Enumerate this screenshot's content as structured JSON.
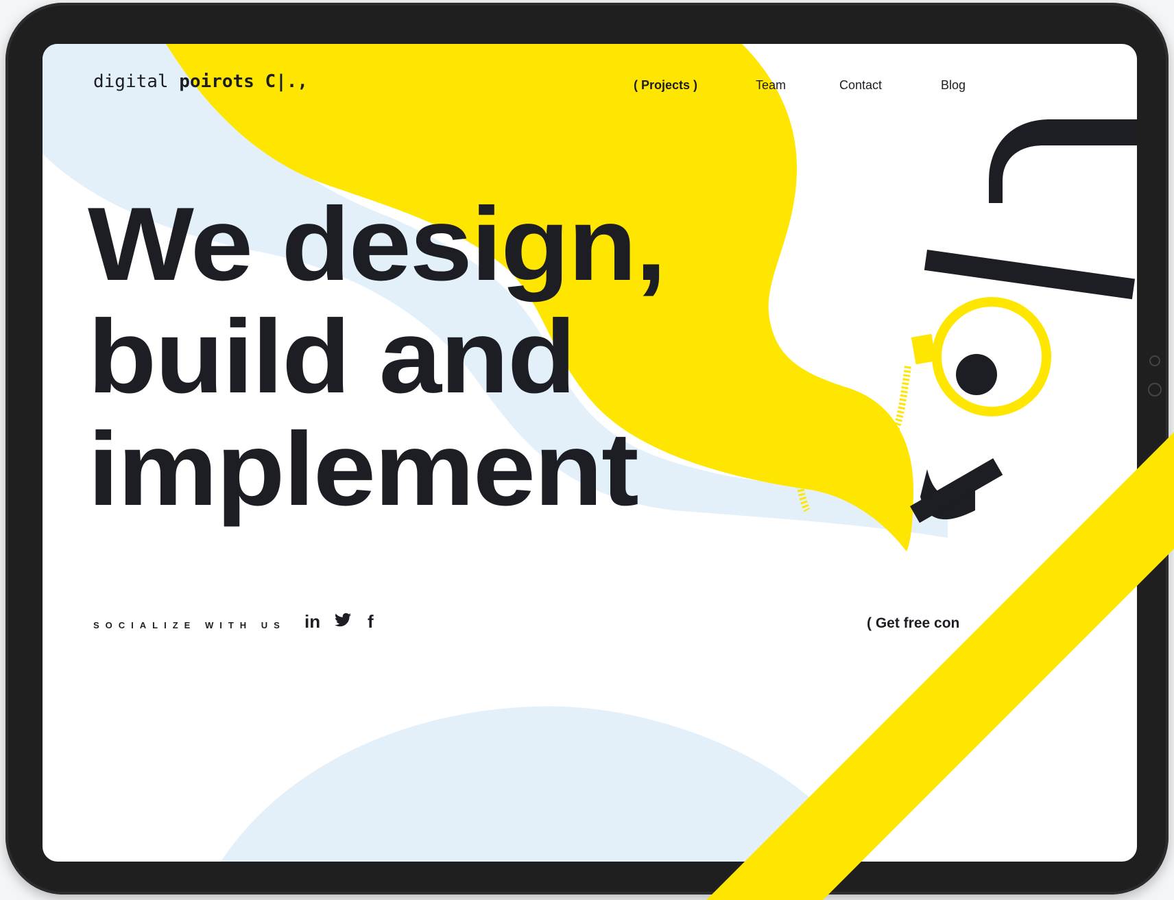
{
  "colors": {
    "accent": "#ffe600",
    "dark": "#1d1d24",
    "light_blue": "#e3f0fa",
    "bezel": "#1f1f20"
  },
  "header": {
    "logo_prefix": "digital ",
    "logo_bold": "poirots C|.,",
    "nav": [
      {
        "label": "( Projects )",
        "active": true
      },
      {
        "label": "Team",
        "active": false
      },
      {
        "label": "Contact",
        "active": false
      },
      {
        "label": "Blog",
        "active": false
      }
    ]
  },
  "hero": {
    "lines": [
      "We design,",
      "build and",
      "implement"
    ]
  },
  "social": {
    "label": "SOCIALIZE WITH US",
    "icons": [
      {
        "name": "linkedin-icon",
        "glyph": "in"
      },
      {
        "name": "twitter-icon",
        "glyph": "🐦"
      },
      {
        "name": "facebook-icon",
        "glyph": "f"
      }
    ]
  },
  "cta": {
    "label": "( Get free con"
  }
}
